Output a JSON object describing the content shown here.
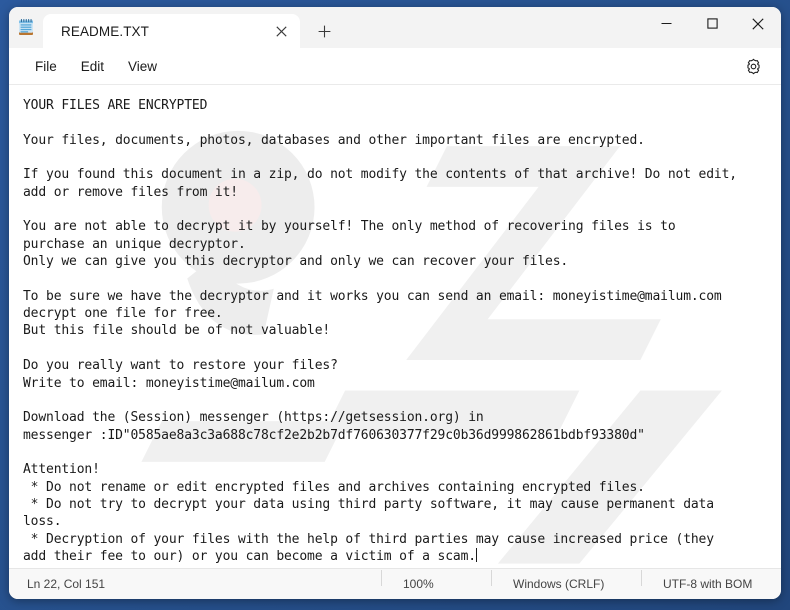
{
  "window": {
    "app_icon": "notepad-icon",
    "minimize_label": "Minimize",
    "maximize_label": "Maximize",
    "close_label": "Close"
  },
  "tabs": [
    {
      "title": "README.TXT",
      "close_label": "Close tab",
      "active": true
    }
  ],
  "new_tab_label": "+",
  "menu": {
    "items": [
      {
        "label": "File"
      },
      {
        "label": "Edit"
      },
      {
        "label": "View"
      }
    ],
    "settings_icon": "gear-icon"
  },
  "editor": {
    "lines": [
      "YOUR FILES ARE ENCRYPTED",
      "",
      "Your files, documents, photos, databases and other important files are encrypted.",
      "",
      "If you found this document in a zip, do not modify the contents of that archive! Do not edit,",
      "add or remove files from it!",
      "",
      "You are not able to decrypt it by yourself! The only method of recovering files is to",
      "purchase an unique decryptor.",
      "Only we can give you this decryptor and only we can recover your files.",
      "",
      "To be sure we have the decryptor and it works you can send an email: moneyistime@mailum.com",
      "decrypt one file for free.",
      "But this file should be of not valuable!",
      "",
      "Do you really want to restore your files?",
      "Write to email: moneyistime@mailum.com",
      "",
      "Download the (Session) messenger (https://getsession.org) in",
      "messenger :ID\"0585ae8a3c3a688c78cf2e2b2b7df760630377f29c0b36d999862861bdbf93380d\"",
      "",
      "Attention!",
      " * Do not rename or edit encrypted files and archives containing encrypted files.",
      " * Do not try to decrypt your data using third party software, it may cause permanent data",
      "loss.",
      " * Decryption of your files with the help of third parties may cause increased price (they",
      "add their fee to our) or you can become a victim of a scam."
    ],
    "contact_email": "moneyistime@mailum.com",
    "session_url": "https://getsession.org",
    "session_id": "0585ae8a3c3a688c78cf2e2b2b7df760630377f29c0b36d999862861bdbf93380d"
  },
  "statusbar": {
    "position": "Ln 22, Col 151",
    "zoom": "100%",
    "line_ending": "Windows (CRLF)",
    "encoding": "UTF-8 with BOM"
  },
  "colors": {
    "desktop": "#2a5699",
    "window_chrome": "#f3f3f3",
    "editor_bg": "#ffffff",
    "text": "#1a1a1a",
    "accent_close_hover": "#c42b1c"
  }
}
